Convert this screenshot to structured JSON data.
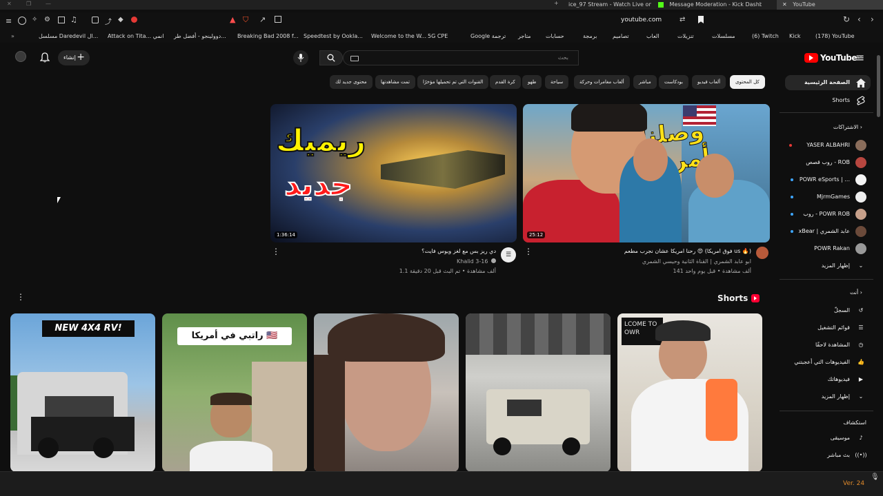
{
  "browser": {
    "tabs": [
      {
        "label": "ice_97 Stream - Watch Live on Kick"
      },
      {
        "label": "Message Moderation - Kick Dashbo..."
      },
      {
        "label": "YouTube"
      }
    ],
    "address": "youtube.com",
    "bookmarks": [
      "Kick",
      "(178) YouTube",
      "(6) Twitch",
      "مسلسلات",
      "تنزيلات",
      "العاب",
      "تصاميم",
      "برمجة",
      "حسابات",
      "متاجر",
      "Google ترجمة",
      "5G CPE",
      "Welcome to the W...",
      "Speedtest by Ookla...",
      "Breaking Bad 2008 f...",
      "دوولينجو - أفضل طر...",
      "Attack on Tita... انمي",
      "مسلسل Daredevil ال..."
    ]
  },
  "masthead": {
    "logo_text": "YouTube",
    "logo_region": "SA",
    "search_placeholder": "بحث",
    "create_label": "إنشاء"
  },
  "chips": [
    {
      "label": "كل المحتوى",
      "active": true
    },
    {
      "label": "ألعاب فيديو"
    },
    {
      "label": "بودكاست"
    },
    {
      "label": "مباشر"
    },
    {
      "label": "ألعاب مغامرات وحركة"
    },
    {
      "label": "سياحة"
    },
    {
      "label": "طهو"
    },
    {
      "label": "كرة القدم"
    },
    {
      "label": "القنوات التي تم تحميلها مؤخرًا"
    },
    {
      "label": "تمت مشاهدتها"
    },
    {
      "label": "محتوى جديد لك"
    }
  ],
  "sidebar": {
    "main": [
      {
        "label": "الصفحة الرئيسية",
        "icon": "home-icon"
      },
      {
        "label": "Shorts",
        "icon": "shorts-icon"
      }
    ],
    "subscriptions_title": "الاشتراكات",
    "subscriptions": [
      {
        "label": "YASER ALBAHRI"
      },
      {
        "label": "روب قصص - ROB"
      },
      {
        "label": "POWR eSports | ..."
      },
      {
        "label": "MjrmGames"
      },
      {
        "label": "روب - POWR ROB"
      },
      {
        "label": "xBear | عابد الشمري"
      },
      {
        "label": "POWR Rakan"
      },
      {
        "label": "إظهار المزيد"
      }
    ],
    "you_title": "أنت",
    "you": [
      {
        "label": "السجلّ",
        "icon": "history-icon"
      },
      {
        "label": "قوائم التشغيل",
        "icon": "playlist-icon"
      },
      {
        "label": "المشاهدة لاحقًا",
        "icon": "clock-icon"
      },
      {
        "label": "الفيديوهات التي أعجبتني",
        "icon": "like-icon"
      },
      {
        "label": "فيديوهاتك",
        "icon": "video-icon"
      },
      {
        "label": "إظهار المزيد",
        "icon": "chevron-down-icon"
      }
    ],
    "explore_title": "استكشاف",
    "explore": [
      {
        "label": "موسيقى",
        "icon": "music-icon"
      },
      {
        "label": "بث مباشر",
        "icon": "live-icon"
      }
    ]
  },
  "videos": [
    {
      "thumb_text": "وصلنا أمريكا",
      "duration": "25:12",
      "title": "رحنا امريكا عشان نجرب مطعم 😍 (فوق امريكا us 🔥)",
      "channel": "ابو عابد الشمري | القناة الثانية وحيسي الشمري",
      "stats": "141 ألف مشاهدة • قبل يوم واحد"
    },
    {
      "thumb_text_1": "ريميك",
      "thumb_text_2": "جديد",
      "duration": "1:36:14",
      "title": "دي ريز بس مع لغز ويوس فايت؟",
      "channel": "Khalid 3-16",
      "stats": "1.1 ألف مشاهدة • تم البث قبل 20 دقيقة"
    }
  ],
  "shorts": {
    "title": "Shorts",
    "items": [
      {
        "overlay": "NEW 4X4 RV!"
      },
      {
        "overlay": "راتبي في أمريكا 🇺🇸"
      },
      {
        "overlay": ""
      },
      {
        "overlay": ""
      },
      {
        "overlay": "LCOME TO OWR"
      }
    ]
  },
  "overlay_version": "Ver. 24",
  "colors": {
    "bg": "#0f0f0f",
    "chip": "#272727",
    "accent_red": "#ff0000"
  }
}
